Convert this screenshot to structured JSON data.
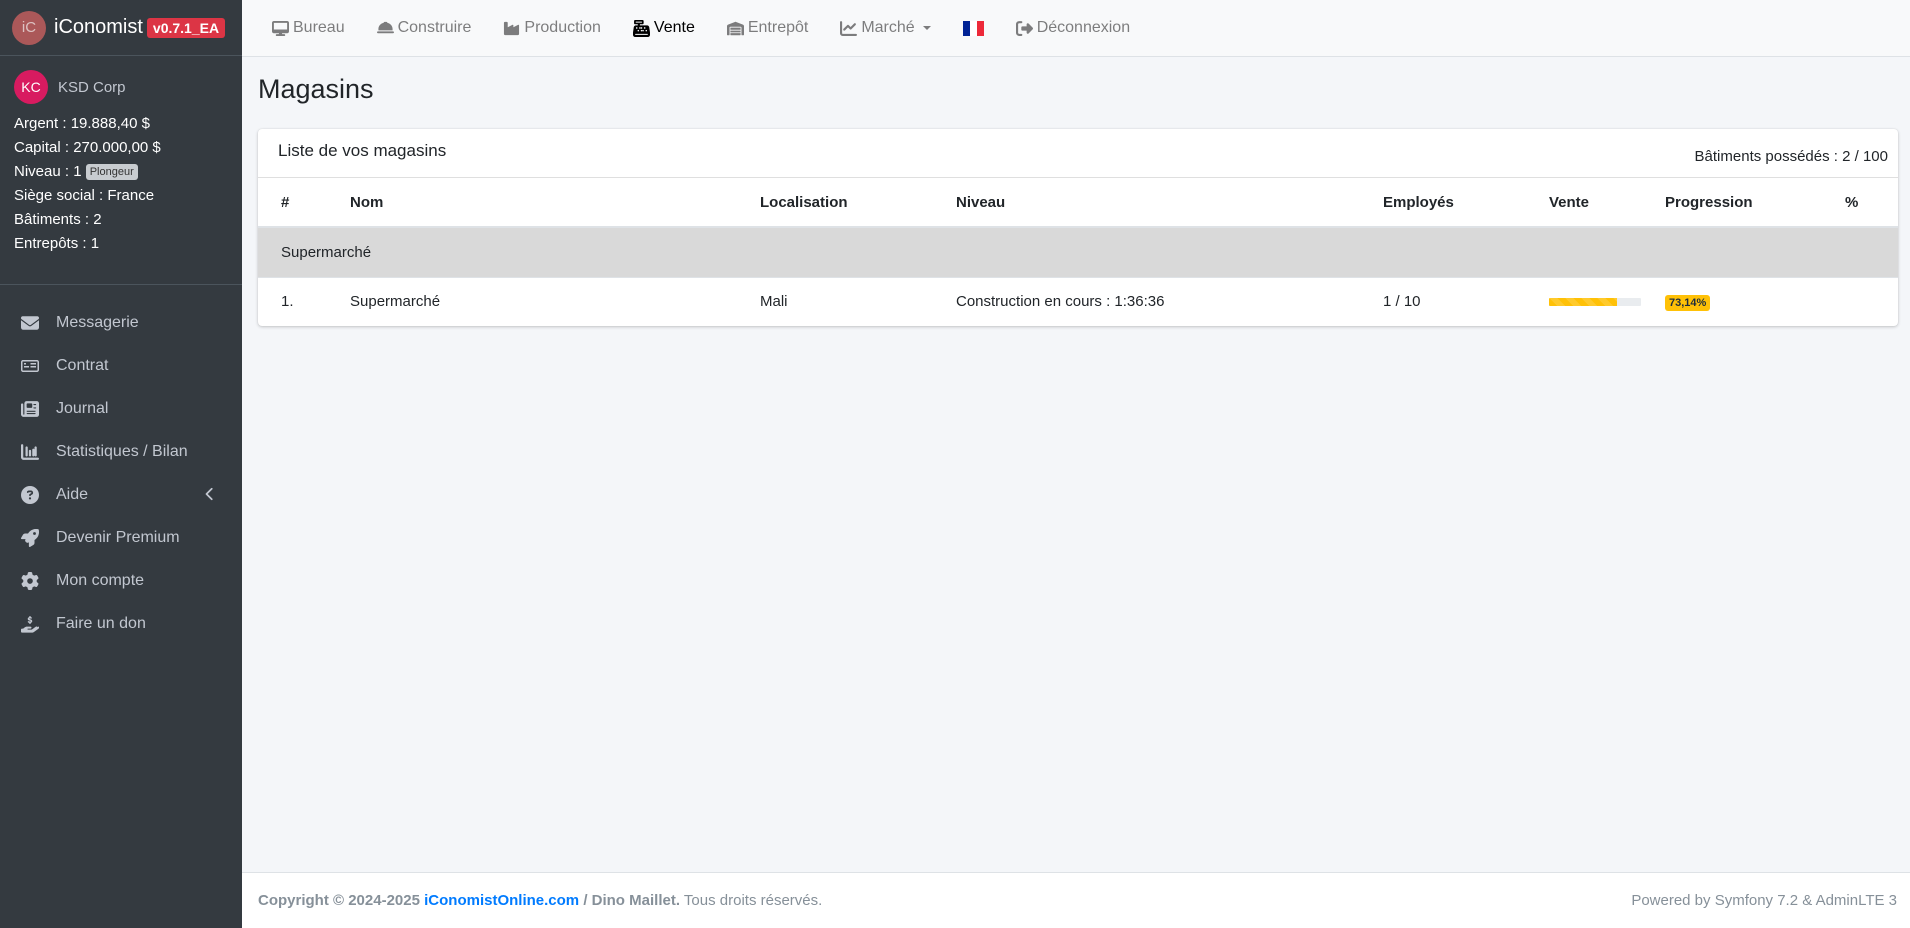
{
  "brand": {
    "logo": "iC",
    "name": "iConomist",
    "version": "v0.7.1_EA",
    "version_color": "#dc3545"
  },
  "user": {
    "initials": "KC",
    "company": "KSD Corp",
    "stats": {
      "argent": "Argent : 19.888,40 $",
      "capital": "Capital : 270.000,00 $",
      "niveau": "Niveau : 1",
      "niveau_badge": "Plongeur",
      "siege": "Siège social : France",
      "batiments": "Bâtiments : 2",
      "entrepots": "Entrepôts : 1"
    }
  },
  "sidebar": {
    "items": [
      {
        "label": "Messagerie",
        "icon": "envelope-icon"
      },
      {
        "label": "Contrat",
        "icon": "money-bill-icon"
      },
      {
        "label": "Journal",
        "icon": "newspaper-icon"
      },
      {
        "label": "Statistiques / Bilan",
        "icon": "chart-bar-icon"
      },
      {
        "label": "Aide",
        "icon": "question-circle-icon"
      },
      {
        "label": "Devenir Premium",
        "icon": "rocket-icon"
      },
      {
        "label": "Mon compte",
        "icon": "gear-icon"
      },
      {
        "label": "Faire un don",
        "icon": "hand-holding-icon"
      }
    ]
  },
  "topnav": {
    "items": [
      {
        "label": "Bureau",
        "icon": "desktop-icon"
      },
      {
        "label": "Construire",
        "icon": "hard-hat-icon"
      },
      {
        "label": "Production",
        "icon": "industry-icon"
      },
      {
        "label": "Vente",
        "icon": "cash-register-icon",
        "active": true
      },
      {
        "label": "Entrepôt",
        "icon": "warehouse-icon"
      },
      {
        "label": "Marché",
        "icon": "chart-line-icon",
        "dropdown": true
      },
      {
        "label": "Déconnexion",
        "icon": "sign-out-icon"
      }
    ],
    "flag": {
      "icon": "france-flag-icon",
      "colors": [
        "#002395",
        "#ffffff",
        "#ed2939"
      ]
    }
  },
  "page": {
    "title": "Magasins"
  },
  "card": {
    "title": "Liste de vos magasins",
    "tools": "Bâtiments possédés : 2 / 100",
    "columns": [
      "#",
      "Nom",
      "Localisation",
      "Niveau",
      "Employés",
      "Vente",
      "Progression",
      "%"
    ],
    "group": "Supermarché",
    "rows": [
      {
        "num": "1.",
        "nom": "Supermarché",
        "localisation": "Mali",
        "niveau": "Construction en cours : 1:36:36",
        "employes": "1 / 10",
        "vente_progress": 0.74,
        "progression": "73,14%"
      }
    ]
  },
  "footer": {
    "copyright": "Copyright © 2024-2025",
    "site": "iConomistOnline.com",
    "author": "/ Dino Maillet.",
    "rights": "Tous droits réservés.",
    "powered": "Powered by Symfony 7.2 & AdminLTE 3"
  }
}
